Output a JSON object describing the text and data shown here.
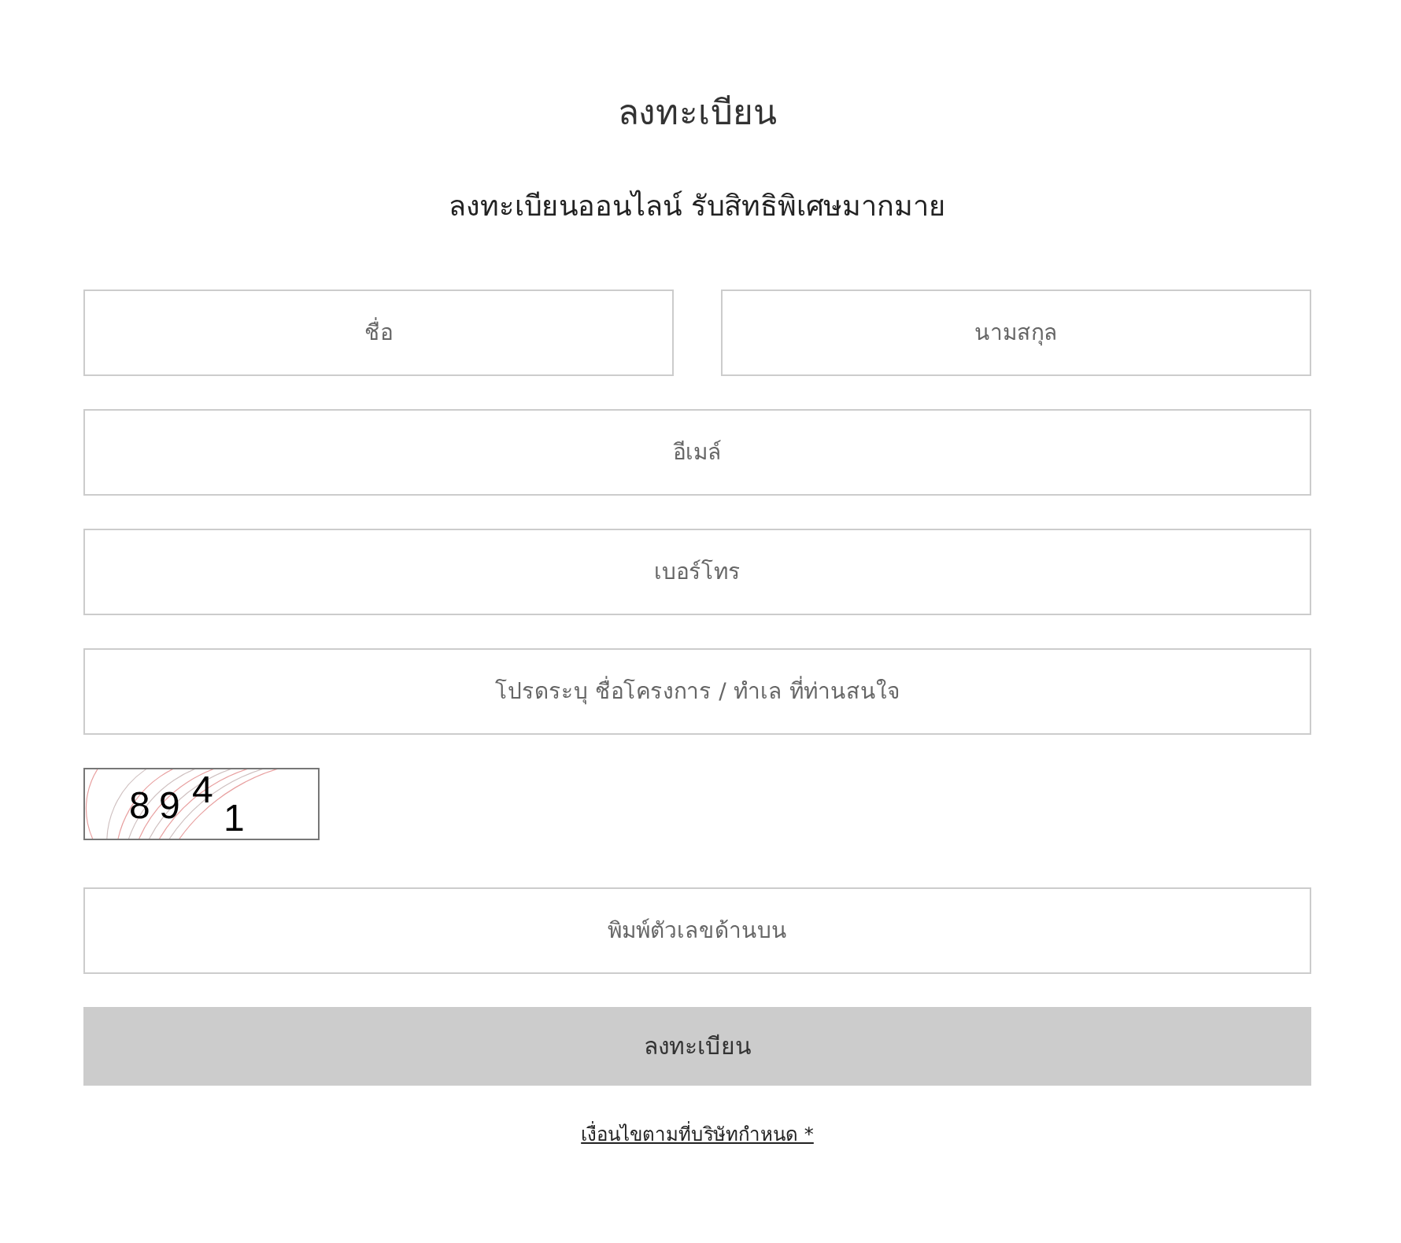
{
  "title": "ลงทะเบียน",
  "subtitle": "ลงทะเบียนออนไลน์ รับสิทธิพิเศษมากมาย",
  "name_row": [
    {
      "placeholder": "ชื่อ"
    },
    {
      "placeholder": "นามสกุล"
    }
  ],
  "fields": [
    {
      "placeholder": "อีเมล์"
    },
    {
      "placeholder": "เบอร์โทร"
    },
    {
      "placeholder": "โปรดระบุ ชื่อโครงการ / ทำเล ที่ท่านสนใจ"
    }
  ],
  "captcha": {
    "digits": [
      "8",
      "9",
      "4",
      "1"
    ]
  },
  "code_field": {
    "placeholder": "พิมพ์ตัวเลขด้านบน"
  },
  "submit_button": "ลงทะเบียน",
  "terms_link": "เงื่อนไขตามที่บริษัทกำหนด *"
}
